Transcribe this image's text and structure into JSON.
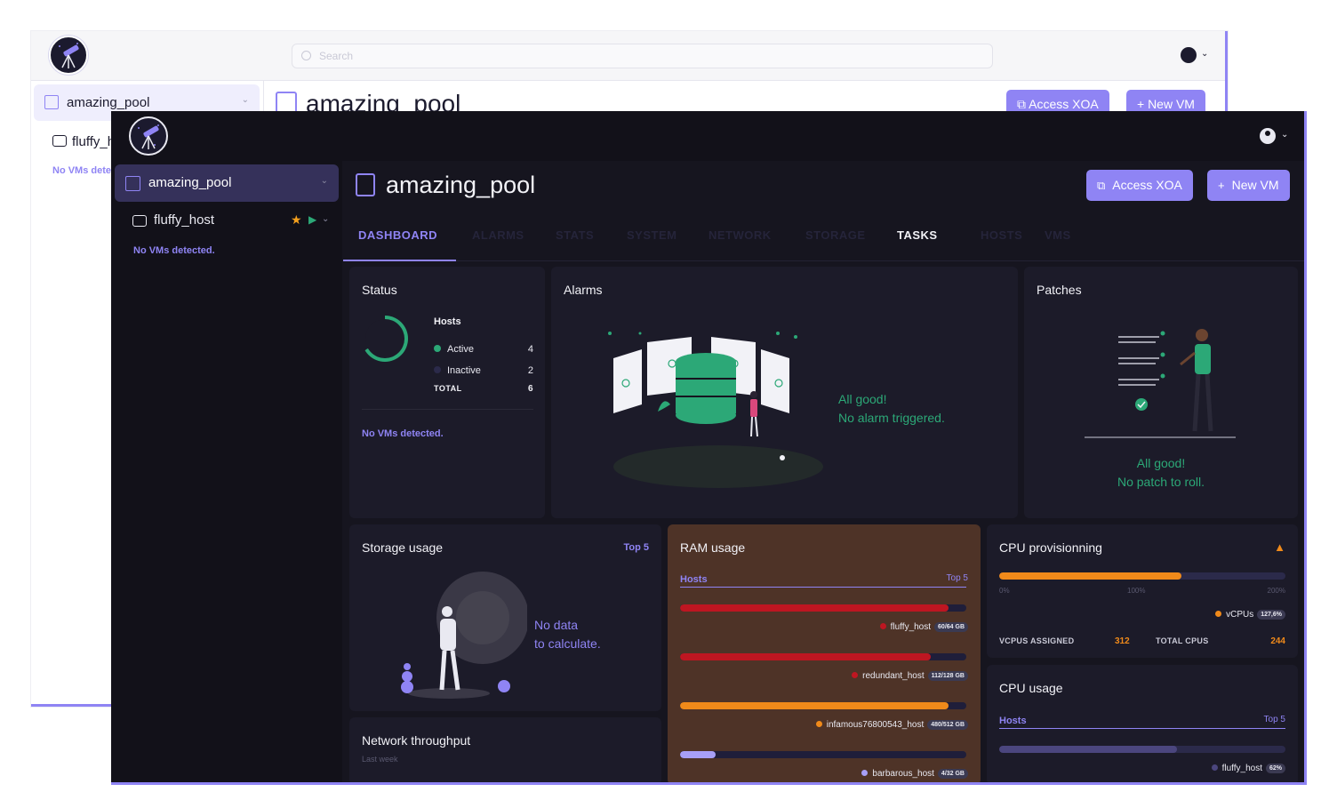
{
  "back_window": {
    "search_placeholder": "Search",
    "sidebar": {
      "pool_label": "amazing_pool",
      "host_label": "fluffy_host",
      "no_vms": "No VMs detected."
    },
    "title": "amazing_pool",
    "buttons": {
      "access_xoa": "Access XOA",
      "new_vm": "+ New VM"
    }
  },
  "front_window": {
    "sidebar": {
      "pool_label": "amazing_pool",
      "host_label": "fluffy_host",
      "no_vms": "No VMs detected."
    },
    "title": "amazing_pool",
    "buttons": {
      "access_xoa": "Access XOA",
      "new_vm": "New VM"
    },
    "tabs": [
      "DASHBOARD",
      "ALARMS",
      "STATS",
      "SYSTEM",
      "NETWORK",
      "STORAGE",
      "TASKS",
      "HOSTS",
      "VMS"
    ],
    "active_tab": "DASHBOARD",
    "status": {
      "title": "Status",
      "hosts_label": "Hosts",
      "active_label": "Active",
      "active_count": "4",
      "inactive_label": "Inactive",
      "inactive_count": "2",
      "total_label": "TOTAL",
      "total_count": "6",
      "no_vms": "No VMs detected."
    },
    "alarms": {
      "title": "Alarms",
      "line1": "All good!",
      "line2": "No alarm triggered."
    },
    "patches": {
      "title": "Patches",
      "line1": "All good!",
      "line2": "No patch to roll."
    },
    "storage": {
      "title": "Storage usage",
      "top5": "Top 5",
      "line1": "No data",
      "line2": "to calculate."
    },
    "network": {
      "title": "Network throughput",
      "subtitle": "Last week"
    },
    "ram": {
      "title": "RAM usage",
      "hosts_label": "Hosts",
      "top5": "Top 5",
      "rows": [
        {
          "host": "fluffy_host",
          "value": "60/64 GB",
          "fraction": 0.9375,
          "color": "#be1621"
        },
        {
          "host": "redundant_host",
          "value": "112/128 GB",
          "fraction": 0.875,
          "color": "#be1621"
        },
        {
          "host": "infamous76800543_host",
          "value": "480/512 GB",
          "fraction": 0.9375,
          "color": "#f08a1a"
        },
        {
          "host": "barbarous_host",
          "value": "4/32 GB",
          "fraction": 0.125,
          "color": "#a79ff7"
        }
      ]
    },
    "cpu_prov": {
      "title": "CPU provisionning",
      "axis": [
        "0%",
        "100%",
        "200%"
      ],
      "legend_label": "vCPUs",
      "legend_value": "127,6%",
      "fraction": 0.638,
      "vcpus_label": "VCPUS ASSIGNED",
      "vcpus_value": "312",
      "total_label": "TOTAL CPUS",
      "total_value": "244"
    },
    "cpu_usage": {
      "title": "CPU usage",
      "hosts_label": "Hosts",
      "top5": "Top 5",
      "rows": [
        {
          "host": "fluffy_host",
          "value": "62%",
          "fraction": 0.62,
          "color": "#4b467e"
        }
      ]
    }
  }
}
